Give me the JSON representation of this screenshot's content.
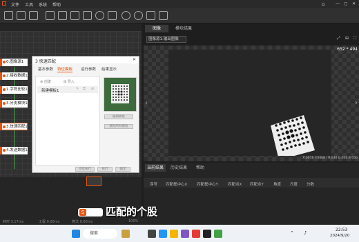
{
  "menu": [
    "文件",
    "工具",
    "系统",
    "帮助"
  ],
  "flow": {
    "nodes": [
      "0.图像源1",
      "2.接收数据1",
      "1.字符比较1",
      "3.分支模块1",
      "3.快速匹配1",
      "4.发送数据1"
    ]
  },
  "dialog": {
    "title": "3 快速匹配",
    "tabs": [
      "基本参数",
      "特征模板",
      "运行参数",
      "结果显示"
    ],
    "toolbar": {
      "create": "创建",
      "import": "导入"
    },
    "template_name": "新建模板1",
    "edit_template": "编辑模板",
    "delete_all": "删除所有模板",
    "buttons": {
      "run_continuous": "连续执行",
      "run": "执行",
      "confirm": "确定"
    }
  },
  "right": {
    "tabs": [
      "图像",
      "模块结果"
    ],
    "image_source": "图像源1.输出图像",
    "image_size": "652 * 494",
    "pixel_readout": "X:0016 Y:0468 | R:030 G:030 B:030",
    "result_tabs": [
      "当前结果",
      "历史结果",
      "帮助"
    ],
    "columns": [
      "序号",
      "匹配框中心X",
      "匹配框中心Y",
      "匹配点X",
      "匹配点Y",
      "角度",
      "尺度",
      "分数"
    ]
  },
  "status": {
    "left": "耗时 3.17ms",
    "mid": "工程 0.00ms",
    "mid2": "算法 0.00ms",
    "zoom": "100%"
  },
  "caption": "匹配的个股",
  "taskbar": {
    "time": "22:53",
    "date": "2024/9/20",
    "search": "搜索"
  }
}
